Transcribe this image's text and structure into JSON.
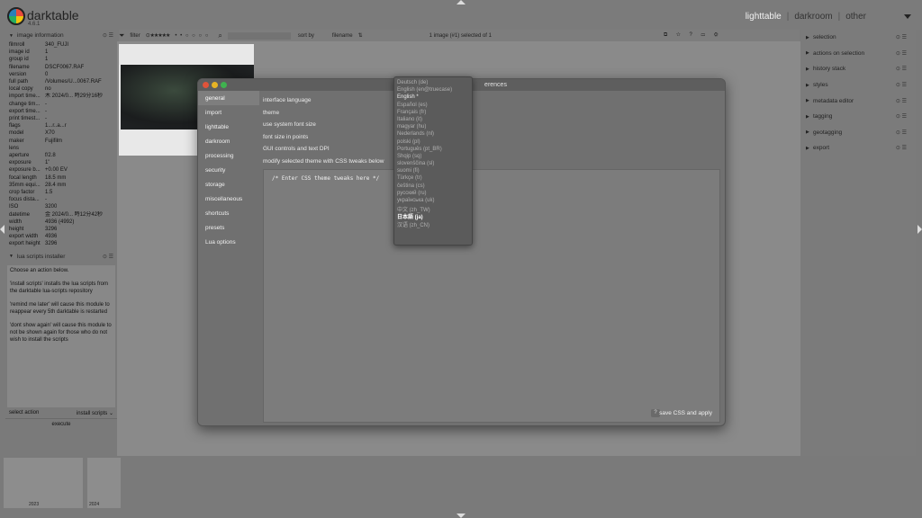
{
  "app": {
    "name": "darktable",
    "version": "4.6.1"
  },
  "views": {
    "lighttable": "lighttable",
    "sep1": "|",
    "darkroom": "darkroom",
    "sep2": "|",
    "other": "other"
  },
  "toolbar": {
    "filter": "filter",
    "sort_label": "sort by",
    "sort_value": "filename",
    "selection": "1 image (#1) selected of 1"
  },
  "image_info": {
    "title": "image information",
    "rows": [
      {
        "k": "filmroll",
        "v": "340_FUJI"
      },
      {
        "k": "image id",
        "v": "1"
      },
      {
        "k": "group id",
        "v": "1"
      },
      {
        "k": "filename",
        "v": "DSCF0067.RAF"
      },
      {
        "k": "version",
        "v": "0"
      },
      {
        "k": "full path",
        "v": "/Volumes/U...0067.RAF"
      },
      {
        "k": "local copy",
        "v": "no"
      },
      {
        "k": "import time...",
        "v": "木 2024/0... 時29分16秒"
      },
      {
        "k": "change tim...",
        "v": "-"
      },
      {
        "k": "export time...",
        "v": "-"
      },
      {
        "k": "print timest...",
        "v": "-"
      },
      {
        "k": "flags",
        "v": "1...r..a...r"
      },
      {
        "k": "model",
        "v": "X70"
      },
      {
        "k": "maker",
        "v": "Fujifilm"
      },
      {
        "k": "lens",
        "v": ""
      },
      {
        "k": "aperture",
        "v": "f/2.8"
      },
      {
        "k": "exposure",
        "v": "1\""
      },
      {
        "k": "exposure b...",
        "v": "+0.00 EV"
      },
      {
        "k": "focal length",
        "v": "18.5 mm"
      },
      {
        "k": "35mm equi...",
        "v": "28.4 mm"
      },
      {
        "k": "crop factor",
        "v": "1.5"
      },
      {
        "k": "focus dista...",
        "v": "-"
      },
      {
        "k": "ISO",
        "v": "3200"
      },
      {
        "k": "datetime",
        "v": "金 2024/0... 時12分42秒"
      },
      {
        "k": "width",
        "v": "4936 (4992)"
      },
      {
        "k": "height",
        "v": "3296"
      },
      {
        "k": "export width",
        "v": "4936"
      },
      {
        "k": "export height",
        "v": "3296"
      }
    ]
  },
  "lua": {
    "title": "lua scripts installer",
    "p1": "Choose an action below.",
    "p2": "'install scripts' installs the lua scripts from the darktable lua-scripts repository",
    "p3": "'remind me later' will cause this module to reappear every 5th darktable is restarted",
    "p4": "'dont show again' will cause this module to not be shown again for those who do not wish to install the scripts",
    "select_label": "select action",
    "select_value": "install scripts",
    "execute": "execute"
  },
  "right_modules": [
    "selection",
    "actions on selection",
    "history stack",
    "styles",
    "metadata editor",
    "tagging",
    "geotagging",
    "export"
  ],
  "filmstrip": {
    "label1": "2023",
    "label2": "2024"
  },
  "dialog": {
    "title": "erences",
    "nav": [
      "general",
      "import",
      "lighttable",
      "darkroom",
      "processing",
      "security",
      "storage",
      "miscellaneous",
      "shortcuts",
      "presets",
      "Lua options"
    ],
    "options": [
      "interface language",
      "theme",
      "use system font size",
      "font size in points",
      "GUI controls and text DPI",
      "modify selected theme with CSS tweaks below"
    ],
    "css_text": "/* Enter CSS theme tweaks here */",
    "help": "?",
    "save_css": "save CSS and apply"
  },
  "languages": [
    "Deutsch (de)",
    "English (en@truecase)",
    "English *",
    "Español (es)",
    "Français (fr)",
    "Italiano (it)",
    "magyar (hu)",
    "Nederlands (nl)",
    "polski (pl)",
    "Português (pt_BR)",
    "Shqip (sq)",
    "slovenščina (sl)",
    "suomi (fi)",
    "Türkçe (tr)",
    "čeština (cs)",
    "русский (ru)",
    "українська (uk)",
    "中文 (zh_TW)",
    "日本語 (ja)",
    "汉语 (zh_CN)"
  ],
  "colors": {
    "accent_red": "#e0533a",
    "accent_yellow": "#e6b324",
    "accent_green": "#3fb24f"
  }
}
